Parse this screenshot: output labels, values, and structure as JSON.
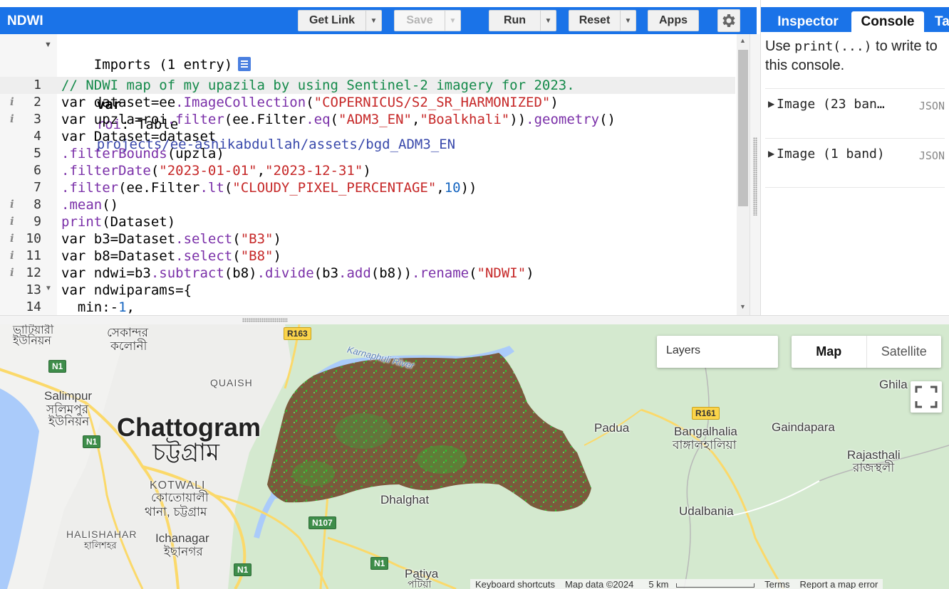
{
  "app": {
    "title": "NDWI"
  },
  "toolbar": {
    "get_link": "Get Link",
    "save": "Save",
    "run": "Run",
    "reset": "Reset",
    "apps": "Apps",
    "dropdown_icon": "chevron-down-icon",
    "settings_icon": "gear-icon"
  },
  "right_panel": {
    "tabs": [
      "Inspector",
      "Console",
      "Ta"
    ],
    "active_tab": "Console",
    "hint_before": "Use ",
    "hint_code": "print(...)",
    "hint_after": " to write to this console.",
    "entries": [
      {
        "text": "Image (23 ban…",
        "tag": "JSON"
      },
      {
        "text": "Image (1 band)",
        "tag": "JSON"
      }
    ]
  },
  "editor": {
    "imports_header": "Imports (1 entry)",
    "import_line": {
      "kw": "var",
      "name": "roi",
      "type": "Table",
      "path": "projects/ee-ashikabdullah/assets/bgd_ADM3_EN"
    },
    "line_numbers": [
      "1",
      "2",
      "3",
      "4",
      "5",
      "6",
      "7",
      "8",
      "9",
      "10",
      "11",
      "12",
      "13",
      "14"
    ],
    "lines": [
      "// NDWI map of my upazila by using Sentinel-2 imagery for 2023.",
      "var dataset=ee.ImageCollection(\"COPERNICUS/S2_SR_HARMONIZED\")",
      "var upzla=roi.filter(ee.Filter.eq(\"ADM3_EN\",\"Boalkhali\")).geometry()",
      "var Dataset=dataset",
      ".filterBounds(upzla)",
      ".filterDate(\"2023-01-01\",\"2023-12-31\")",
      ".filter(ee.Filter.lt(\"CLOUDY_PIXEL_PERCENTAGE\",10))",
      ".mean()",
      "print(Dataset)",
      "var b3=Dataset.select(\"B3\")",
      "var b8=Dataset.select(\"B8\")",
      "var ndwi=b3.subtract(b8).divide(b3.add(b8)).rename(\"NDWI\")",
      "var ndwiparams={",
      "  min:-1,"
    ]
  },
  "map": {
    "layers_label": "Layers",
    "map_type_map": "Map",
    "map_type_satellite": "Satellite",
    "labels": {
      "city": "Chattogram",
      "city_bn": "চট্টগ্রাম",
      "salimpur": "Salimpur",
      "salimpur_bn1": "সলিমপুর",
      "salimpur_bn2": "ইউনিয়ন",
      "top_left_bn1": "ভাটিয়ারী",
      "top_left_bn2": "ইউনিয়ন",
      "sekandar_bn1": "সেকান্দর",
      "sekandar_bn2": "কলোনী",
      "quaish": "QUAISH",
      "kotwali": "KOTWALI",
      "kotwali_bn1": "কোতোয়ালী",
      "kotwali_bn2": "থানা, চট্টগ্রাম",
      "halishahar": "HALISHAHAR",
      "halishahar_bn": "হালিশহর",
      "ichanagar": "Ichanagar",
      "ichanagar_bn": "ইছানগর",
      "dhalghat": "Dhalghat",
      "padua": "Padua",
      "bangalhalia": "Bangalhalia",
      "bangalhalia_bn": "বাঙ্গালহালিয়া",
      "gaindapara": "Gaindapara",
      "rajasthali": "Rajasthali",
      "rajasthali_bn": "রাজস্থলী",
      "udalbania": "Udalbania",
      "ghila": "Ghila",
      "patiya": "Patiya",
      "patiya_bn": "পটিয়া",
      "river": "Karnaphuli River"
    },
    "shields": {
      "r163": "R163",
      "n1_a": "N1",
      "n1_b": "N1",
      "n1_c": "N1",
      "n1_d": "N1",
      "n107": "N107",
      "r161": "R161",
      "r161_b": "R161"
    },
    "attribution": {
      "keyboard": "Keyboard shortcuts",
      "data": "Map data ©2024",
      "scale": "5 km",
      "terms": "Terms",
      "report": "Report a map error"
    },
    "fullscreen_icon": "fullscreen-icon"
  },
  "colors": {
    "accent": "#1a73e8",
    "ndwi_land": "#7a5a3c",
    "ndwi_water": "#2fbf2f",
    "map_green": "#d4e9cf",
    "water": "#aacbfa"
  }
}
